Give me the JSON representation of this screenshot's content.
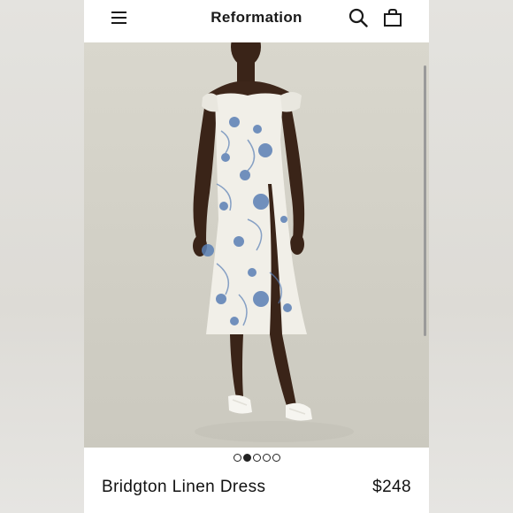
{
  "header": {
    "brand": "Reformation",
    "menu_icon": "hamburger-menu-icon",
    "search_icon": "search-icon",
    "bag_icon": "shopping-bag-icon"
  },
  "gallery": {
    "image_count": 5,
    "active_index": 1
  },
  "product": {
    "name": "Bridgton Linen Dress",
    "price": "$248"
  },
  "colors": {
    "print_blue": "#5a7fb5",
    "dress_base": "#f1efe8",
    "backdrop": "#d9d7cd"
  }
}
